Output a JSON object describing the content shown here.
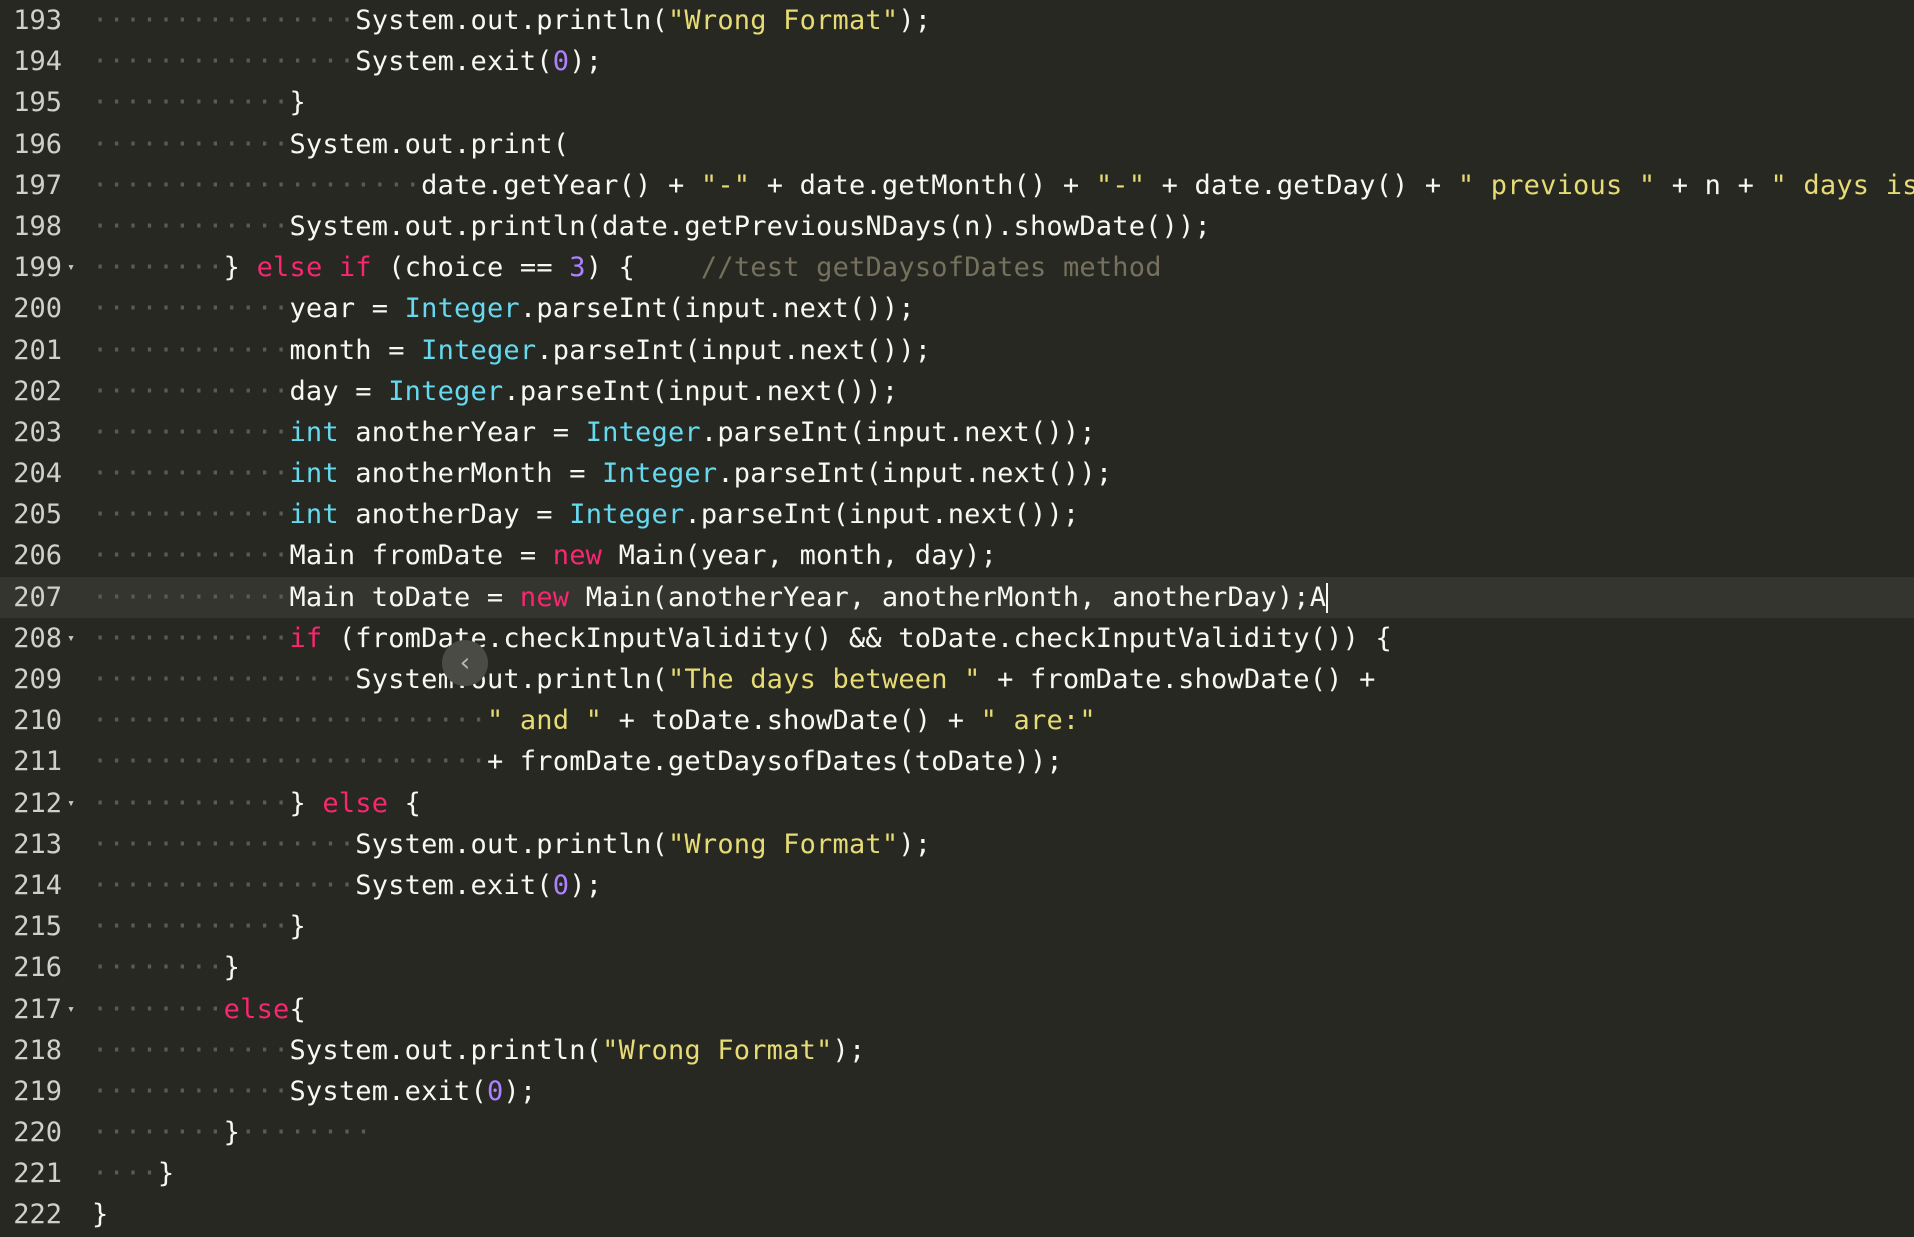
{
  "editor": {
    "cursor_line": "207",
    "scroll_button_label": "‹",
    "lines": [
      {
        "num": "193",
        "fold": "",
        "tokens": [
          {
            "t": "················",
            "c": "ind"
          },
          {
            "t": "System.out.println(",
            "c": ""
          },
          {
            "t": "\"Wrong Format\"",
            "c": "str"
          },
          {
            "t": ");",
            "c": ""
          }
        ]
      },
      {
        "num": "194",
        "fold": "",
        "tokens": [
          {
            "t": "················",
            "c": "ind"
          },
          {
            "t": "System.exit(",
            "c": ""
          },
          {
            "t": "0",
            "c": "num"
          },
          {
            "t": ");",
            "c": ""
          }
        ]
      },
      {
        "num": "195",
        "fold": "",
        "tokens": [
          {
            "t": "············",
            "c": "ind"
          },
          {
            "t": "}",
            "c": ""
          }
        ]
      },
      {
        "num": "196",
        "fold": "",
        "tokens": [
          {
            "t": "············",
            "c": "ind"
          },
          {
            "t": "System.out.print(",
            "c": ""
          }
        ]
      },
      {
        "num": "197",
        "fold": "",
        "tokens": [
          {
            "t": "····················",
            "c": "ind"
          },
          {
            "t": "date.getYear() + ",
            "c": ""
          },
          {
            "t": "\"-\"",
            "c": "str"
          },
          {
            "t": " + date.getMonth() + ",
            "c": ""
          },
          {
            "t": "\"-\"",
            "c": "str"
          },
          {
            "t": " + date.getDay() + ",
            "c": ""
          },
          {
            "t": "\" previous \"",
            "c": "str"
          },
          {
            "t": " + n + ",
            "c": ""
          },
          {
            "t": "\" days is:\"",
            "c": "str"
          },
          {
            "t": ");",
            "c": ""
          }
        ]
      },
      {
        "num": "198",
        "fold": "",
        "tokens": [
          {
            "t": "············",
            "c": "ind"
          },
          {
            "t": "System.out.println(date.getPreviousNDays(n).showDate());",
            "c": ""
          }
        ]
      },
      {
        "num": "199",
        "fold": "▾",
        "tokens": [
          {
            "t": "········",
            "c": "ind"
          },
          {
            "t": "} ",
            "c": ""
          },
          {
            "t": "else if",
            "c": "kw"
          },
          {
            "t": " (choice == ",
            "c": ""
          },
          {
            "t": "3",
            "c": "num"
          },
          {
            "t": ") {    ",
            "c": ""
          },
          {
            "t": "//test getDaysofDates method",
            "c": "cmt"
          }
        ]
      },
      {
        "num": "200",
        "fold": "",
        "tokens": [
          {
            "t": "············",
            "c": "ind"
          },
          {
            "t": "year = ",
            "c": ""
          },
          {
            "t": "Integer",
            "c": "typ"
          },
          {
            "t": ".parseInt(input.next());",
            "c": ""
          }
        ]
      },
      {
        "num": "201",
        "fold": "",
        "tokens": [
          {
            "t": "············",
            "c": "ind"
          },
          {
            "t": "month = ",
            "c": ""
          },
          {
            "t": "Integer",
            "c": "typ"
          },
          {
            "t": ".parseInt(input.next());",
            "c": ""
          }
        ]
      },
      {
        "num": "202",
        "fold": "",
        "tokens": [
          {
            "t": "············",
            "c": "ind"
          },
          {
            "t": "day = ",
            "c": ""
          },
          {
            "t": "Integer",
            "c": "typ"
          },
          {
            "t": ".parseInt(input.next());",
            "c": ""
          }
        ]
      },
      {
        "num": "203",
        "fold": "",
        "tokens": [
          {
            "t": "············",
            "c": "ind"
          },
          {
            "t": "int",
            "c": "typ"
          },
          {
            "t": " anotherYear = ",
            "c": ""
          },
          {
            "t": "Integer",
            "c": "typ"
          },
          {
            "t": ".parseInt(input.next());",
            "c": ""
          }
        ]
      },
      {
        "num": "204",
        "fold": "",
        "tokens": [
          {
            "t": "············",
            "c": "ind"
          },
          {
            "t": "int",
            "c": "typ"
          },
          {
            "t": " anotherMonth = ",
            "c": ""
          },
          {
            "t": "Integer",
            "c": "typ"
          },
          {
            "t": ".parseInt(input.next());",
            "c": ""
          }
        ]
      },
      {
        "num": "205",
        "fold": "",
        "tokens": [
          {
            "t": "············",
            "c": "ind"
          },
          {
            "t": "int",
            "c": "typ"
          },
          {
            "t": " anotherDay = ",
            "c": ""
          },
          {
            "t": "Integer",
            "c": "typ"
          },
          {
            "t": ".parseInt(input.next());",
            "c": ""
          }
        ]
      },
      {
        "num": "206",
        "fold": "",
        "tokens": [
          {
            "t": "············",
            "c": "ind"
          },
          {
            "t": "Main fromDate = ",
            "c": ""
          },
          {
            "t": "new",
            "c": "kw"
          },
          {
            "t": " Main(year, month, day);",
            "c": ""
          }
        ]
      },
      {
        "num": "207",
        "fold": "",
        "tokens": [
          {
            "t": "············",
            "c": "ind"
          },
          {
            "t": "Main toDate = ",
            "c": ""
          },
          {
            "t": "new",
            "c": "kw"
          },
          {
            "t": " Main(anotherYear, anotherMonth, anotherDay);A",
            "c": ""
          }
        ]
      },
      {
        "num": "208",
        "fold": "▾",
        "tokens": [
          {
            "t": "············",
            "c": "ind"
          },
          {
            "t": "if",
            "c": "kw"
          },
          {
            "t": " (fromDate.checkInputValidity() && toDate.checkInputValidity()) {",
            "c": ""
          }
        ]
      },
      {
        "num": "209",
        "fold": "",
        "tokens": [
          {
            "t": "················",
            "c": "ind"
          },
          {
            "t": "System.out.println(",
            "c": ""
          },
          {
            "t": "\"The days between \"",
            "c": "str"
          },
          {
            "t": " + fromDate.showDate() +",
            "c": ""
          }
        ]
      },
      {
        "num": "210",
        "fold": "",
        "tokens": [
          {
            "t": "························",
            "c": "ind"
          },
          {
            "t": "\" and \"",
            "c": "str"
          },
          {
            "t": " + toDate.showDate() + ",
            "c": ""
          },
          {
            "t": "\" are:\"",
            "c": "str"
          }
        ]
      },
      {
        "num": "211",
        "fold": "",
        "tokens": [
          {
            "t": "························",
            "c": "ind"
          },
          {
            "t": "+ fromDate.getDaysofDates(toDate));",
            "c": ""
          }
        ]
      },
      {
        "num": "212",
        "fold": "▾",
        "tokens": [
          {
            "t": "············",
            "c": "ind"
          },
          {
            "t": "} ",
            "c": ""
          },
          {
            "t": "else",
            "c": "kw"
          },
          {
            "t": " {",
            "c": ""
          }
        ]
      },
      {
        "num": "213",
        "fold": "",
        "tokens": [
          {
            "t": "················",
            "c": "ind"
          },
          {
            "t": "System.out.println(",
            "c": ""
          },
          {
            "t": "\"Wrong Format\"",
            "c": "str"
          },
          {
            "t": ");",
            "c": ""
          }
        ]
      },
      {
        "num": "214",
        "fold": "",
        "tokens": [
          {
            "t": "················",
            "c": "ind"
          },
          {
            "t": "System.exit(",
            "c": ""
          },
          {
            "t": "0",
            "c": "num"
          },
          {
            "t": ");",
            "c": ""
          }
        ]
      },
      {
        "num": "215",
        "fold": "",
        "tokens": [
          {
            "t": "············",
            "c": "ind"
          },
          {
            "t": "}",
            "c": ""
          }
        ]
      },
      {
        "num": "216",
        "fold": "",
        "tokens": [
          {
            "t": "········",
            "c": "ind"
          },
          {
            "t": "}",
            "c": ""
          }
        ]
      },
      {
        "num": "217",
        "fold": "▾",
        "tokens": [
          {
            "t": "········",
            "c": "ind"
          },
          {
            "t": "else",
            "c": "kw"
          },
          {
            "t": "{",
            "c": ""
          }
        ]
      },
      {
        "num": "218",
        "fold": "",
        "tokens": [
          {
            "t": "············",
            "c": "ind"
          },
          {
            "t": "System.out.println(",
            "c": ""
          },
          {
            "t": "\"Wrong Format\"",
            "c": "str"
          },
          {
            "t": ");",
            "c": ""
          }
        ]
      },
      {
        "num": "219",
        "fold": "",
        "tokens": [
          {
            "t": "············",
            "c": "ind"
          },
          {
            "t": "System.exit(",
            "c": ""
          },
          {
            "t": "0",
            "c": "num"
          },
          {
            "t": ");",
            "c": ""
          }
        ]
      },
      {
        "num": "220",
        "fold": "",
        "tokens": [
          {
            "t": "········",
            "c": "ind"
          },
          {
            "t": "}",
            "c": ""
          },
          {
            "t": "········",
            "c": "ind"
          }
        ]
      },
      {
        "num": "221",
        "fold": "",
        "tokens": [
          {
            "t": "····",
            "c": "ind"
          },
          {
            "t": "}",
            "c": ""
          }
        ]
      },
      {
        "num": "222",
        "fold": "",
        "tokens": [
          {
            "t": "}",
            "c": ""
          }
        ]
      }
    ]
  }
}
